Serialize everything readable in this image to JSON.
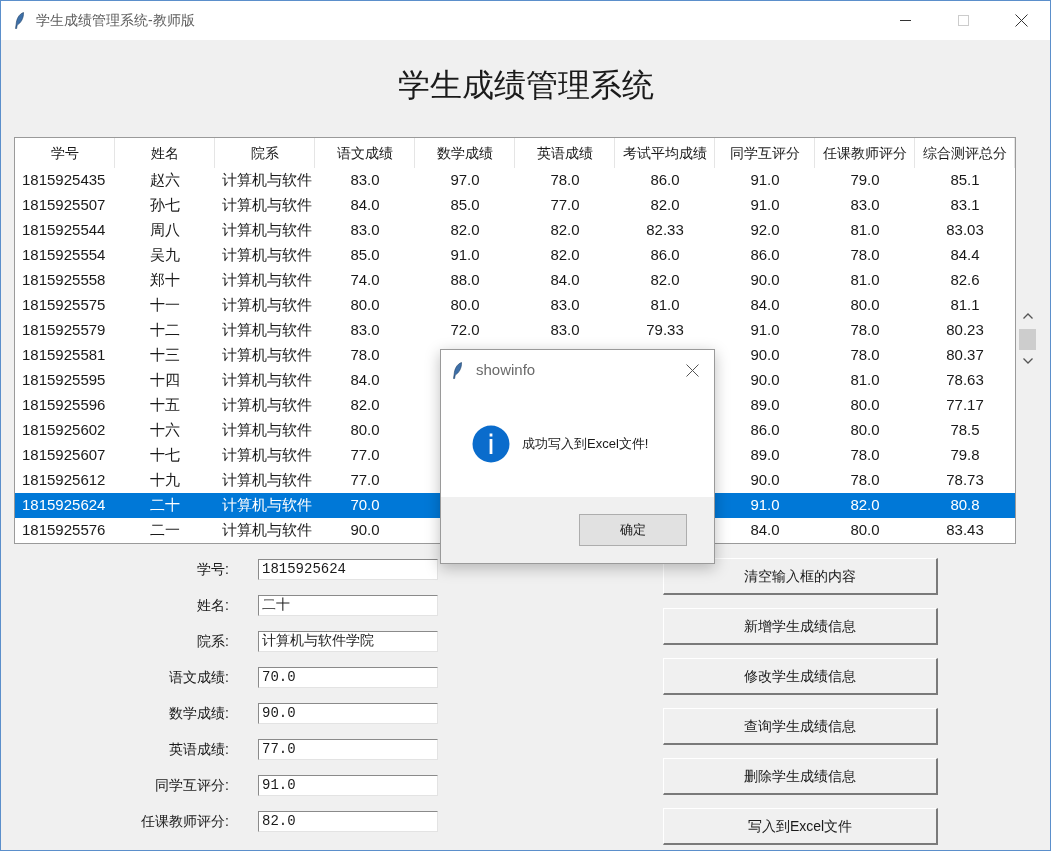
{
  "window": {
    "title": "学生成绩管理系统-教师版",
    "maximize_disabled": true
  },
  "heading": "学生成绩管理系统",
  "table": {
    "columns": [
      "学号",
      "姓名",
      "院系",
      "语文成绩",
      "数学成绩",
      "英语成绩",
      "考试平均成绩",
      "同学互评分",
      "任课教师评分",
      "综合测评总分"
    ],
    "rows": [
      {
        "selected": false,
        "cells": [
          "1815925435",
          "赵六",
          "计算机与软件",
          "83.0",
          "97.0",
          "78.0",
          "86.0",
          "91.0",
          "79.0",
          "85.1"
        ]
      },
      {
        "selected": false,
        "cells": [
          "1815925507",
          "孙七",
          "计算机与软件",
          "84.0",
          "85.0",
          "77.0",
          "82.0",
          "91.0",
          "83.0",
          "83.1"
        ]
      },
      {
        "selected": false,
        "cells": [
          "1815925544",
          "周八",
          "计算机与软件",
          "83.0",
          "82.0",
          "82.0",
          "82.33",
          "92.0",
          "81.0",
          "83.03"
        ]
      },
      {
        "selected": false,
        "cells": [
          "1815925554",
          "吴九",
          "计算机与软件",
          "85.0",
          "91.0",
          "82.0",
          "86.0",
          "86.0",
          "78.0",
          "84.4"
        ]
      },
      {
        "selected": false,
        "cells": [
          "1815925558",
          "郑十",
          "计算机与软件",
          "74.0",
          "88.0",
          "84.0",
          "82.0",
          "90.0",
          "81.0",
          "82.6"
        ]
      },
      {
        "selected": false,
        "cells": [
          "1815925575",
          "十一",
          "计算机与软件",
          "80.0",
          "80.0",
          "83.0",
          "81.0",
          "84.0",
          "80.0",
          "81.1"
        ]
      },
      {
        "selected": false,
        "cells": [
          "1815925579",
          "十二",
          "计算机与软件",
          "83.0",
          "72.0",
          "83.0",
          "79.33",
          "91.0",
          "78.0",
          "80.23"
        ]
      },
      {
        "selected": false,
        "cells": [
          "1815925581",
          "十三",
          "计算机与软件",
          "78.0",
          null,
          null,
          null,
          "90.0",
          "78.0",
          "80.37"
        ]
      },
      {
        "selected": false,
        "cells": [
          "1815925595",
          "十四",
          "计算机与软件",
          "84.0",
          null,
          null,
          null,
          "90.0",
          "81.0",
          "78.63"
        ]
      },
      {
        "selected": false,
        "cells": [
          "1815925596",
          "十五",
          "计算机与软件",
          "82.0",
          null,
          null,
          null,
          "89.0",
          "80.0",
          "77.17"
        ]
      },
      {
        "selected": false,
        "cells": [
          "1815925602",
          "十六",
          "计算机与软件",
          "80.0",
          null,
          null,
          null,
          "86.0",
          "80.0",
          "78.5"
        ]
      },
      {
        "selected": false,
        "cells": [
          "1815925607",
          "十七",
          "计算机与软件",
          "77.0",
          null,
          null,
          null,
          "89.0",
          "78.0",
          "79.8"
        ]
      },
      {
        "selected": false,
        "cells": [
          "1815925612",
          "十九",
          "计算机与软件",
          "77.0",
          null,
          null,
          null,
          "90.0",
          "78.0",
          "78.73"
        ]
      },
      {
        "selected": true,
        "cells": [
          "1815925624",
          "二十",
          "计算机与软件",
          "70.0",
          null,
          null,
          null,
          "91.0",
          "82.0",
          "80.8"
        ]
      },
      {
        "selected": false,
        "cells": [
          "1815925576",
          "二一",
          "计算机与软件",
          "90.0",
          null,
          null,
          null,
          "84.0",
          "80.0",
          "83.43"
        ]
      }
    ]
  },
  "form": {
    "fields": [
      {
        "label": "学号:",
        "value": "1815925624"
      },
      {
        "label": "姓名:",
        "value": "二十"
      },
      {
        "label": "院系:",
        "value": "计算机与软件学院"
      },
      {
        "label": "语文成绩:",
        "value": "70.0"
      },
      {
        "label": "数学成绩:",
        "value": "90.0"
      },
      {
        "label": "英语成绩:",
        "value": "77.0"
      },
      {
        "label": "同学互评分:",
        "value": "91.0"
      },
      {
        "label": "任课教师评分:",
        "value": "82.0"
      }
    ]
  },
  "buttons": [
    "清空输入框的内容",
    "新增学生成绩信息",
    "修改学生成绩信息",
    "查询学生成绩信息",
    "删除学生成绩信息",
    "写入到Excel文件"
  ],
  "dialog": {
    "title": "showinfo",
    "message": "成功写入到Excel文件!",
    "button": "确定"
  }
}
